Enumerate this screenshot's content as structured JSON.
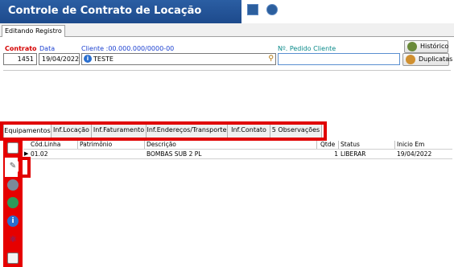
{
  "window": {
    "title": "Controle de Contrato de Locação"
  },
  "top_tab": {
    "label": "Editando Registro"
  },
  "form": {
    "contrato_label": "Contrato",
    "data_label": "Data",
    "cliente_label": "Cliente :00.000.000/0000-00",
    "pedido_label": "Nº. Pedido Cliente",
    "contrato_value": "1451",
    "data_value": "19/04/2022",
    "cliente_value": "TESTE",
    "pedido_value": ""
  },
  "buttons": {
    "historico": "Histórico",
    "duplicatas": "Duplicatas"
  },
  "tabs": [
    "Equipamentos",
    "Inf.Locação",
    "Inf.Faturamento",
    "Inf.Endereços/Transporte",
    "Inf.Contato",
    "5 Observações"
  ],
  "grid": {
    "columns": [
      "Cód.Linha",
      "Patrimônio",
      "Descrição",
      "Qtde",
      "Status",
      "Inicio Em"
    ],
    "rows": [
      {
        "codigo": "01.02",
        "patrimonio": "",
        "descricao": "BOMBAS SUB 2 PL",
        "qtde": "1",
        "status": "LIBERAR",
        "inicio": "19/04/2022"
      }
    ]
  },
  "side_icons": [
    "new-document-icon",
    "edit-pencil-icon",
    "tools-icon",
    "globe-icon",
    "info-icon",
    "tree-icon",
    "mail-icon"
  ],
  "colors": {
    "title_bar": "#1d4a8c",
    "highlight": "#e00000",
    "label_red": "#d40000",
    "label_blue": "#1a3fd0",
    "label_teal": "#0a8a8a"
  }
}
